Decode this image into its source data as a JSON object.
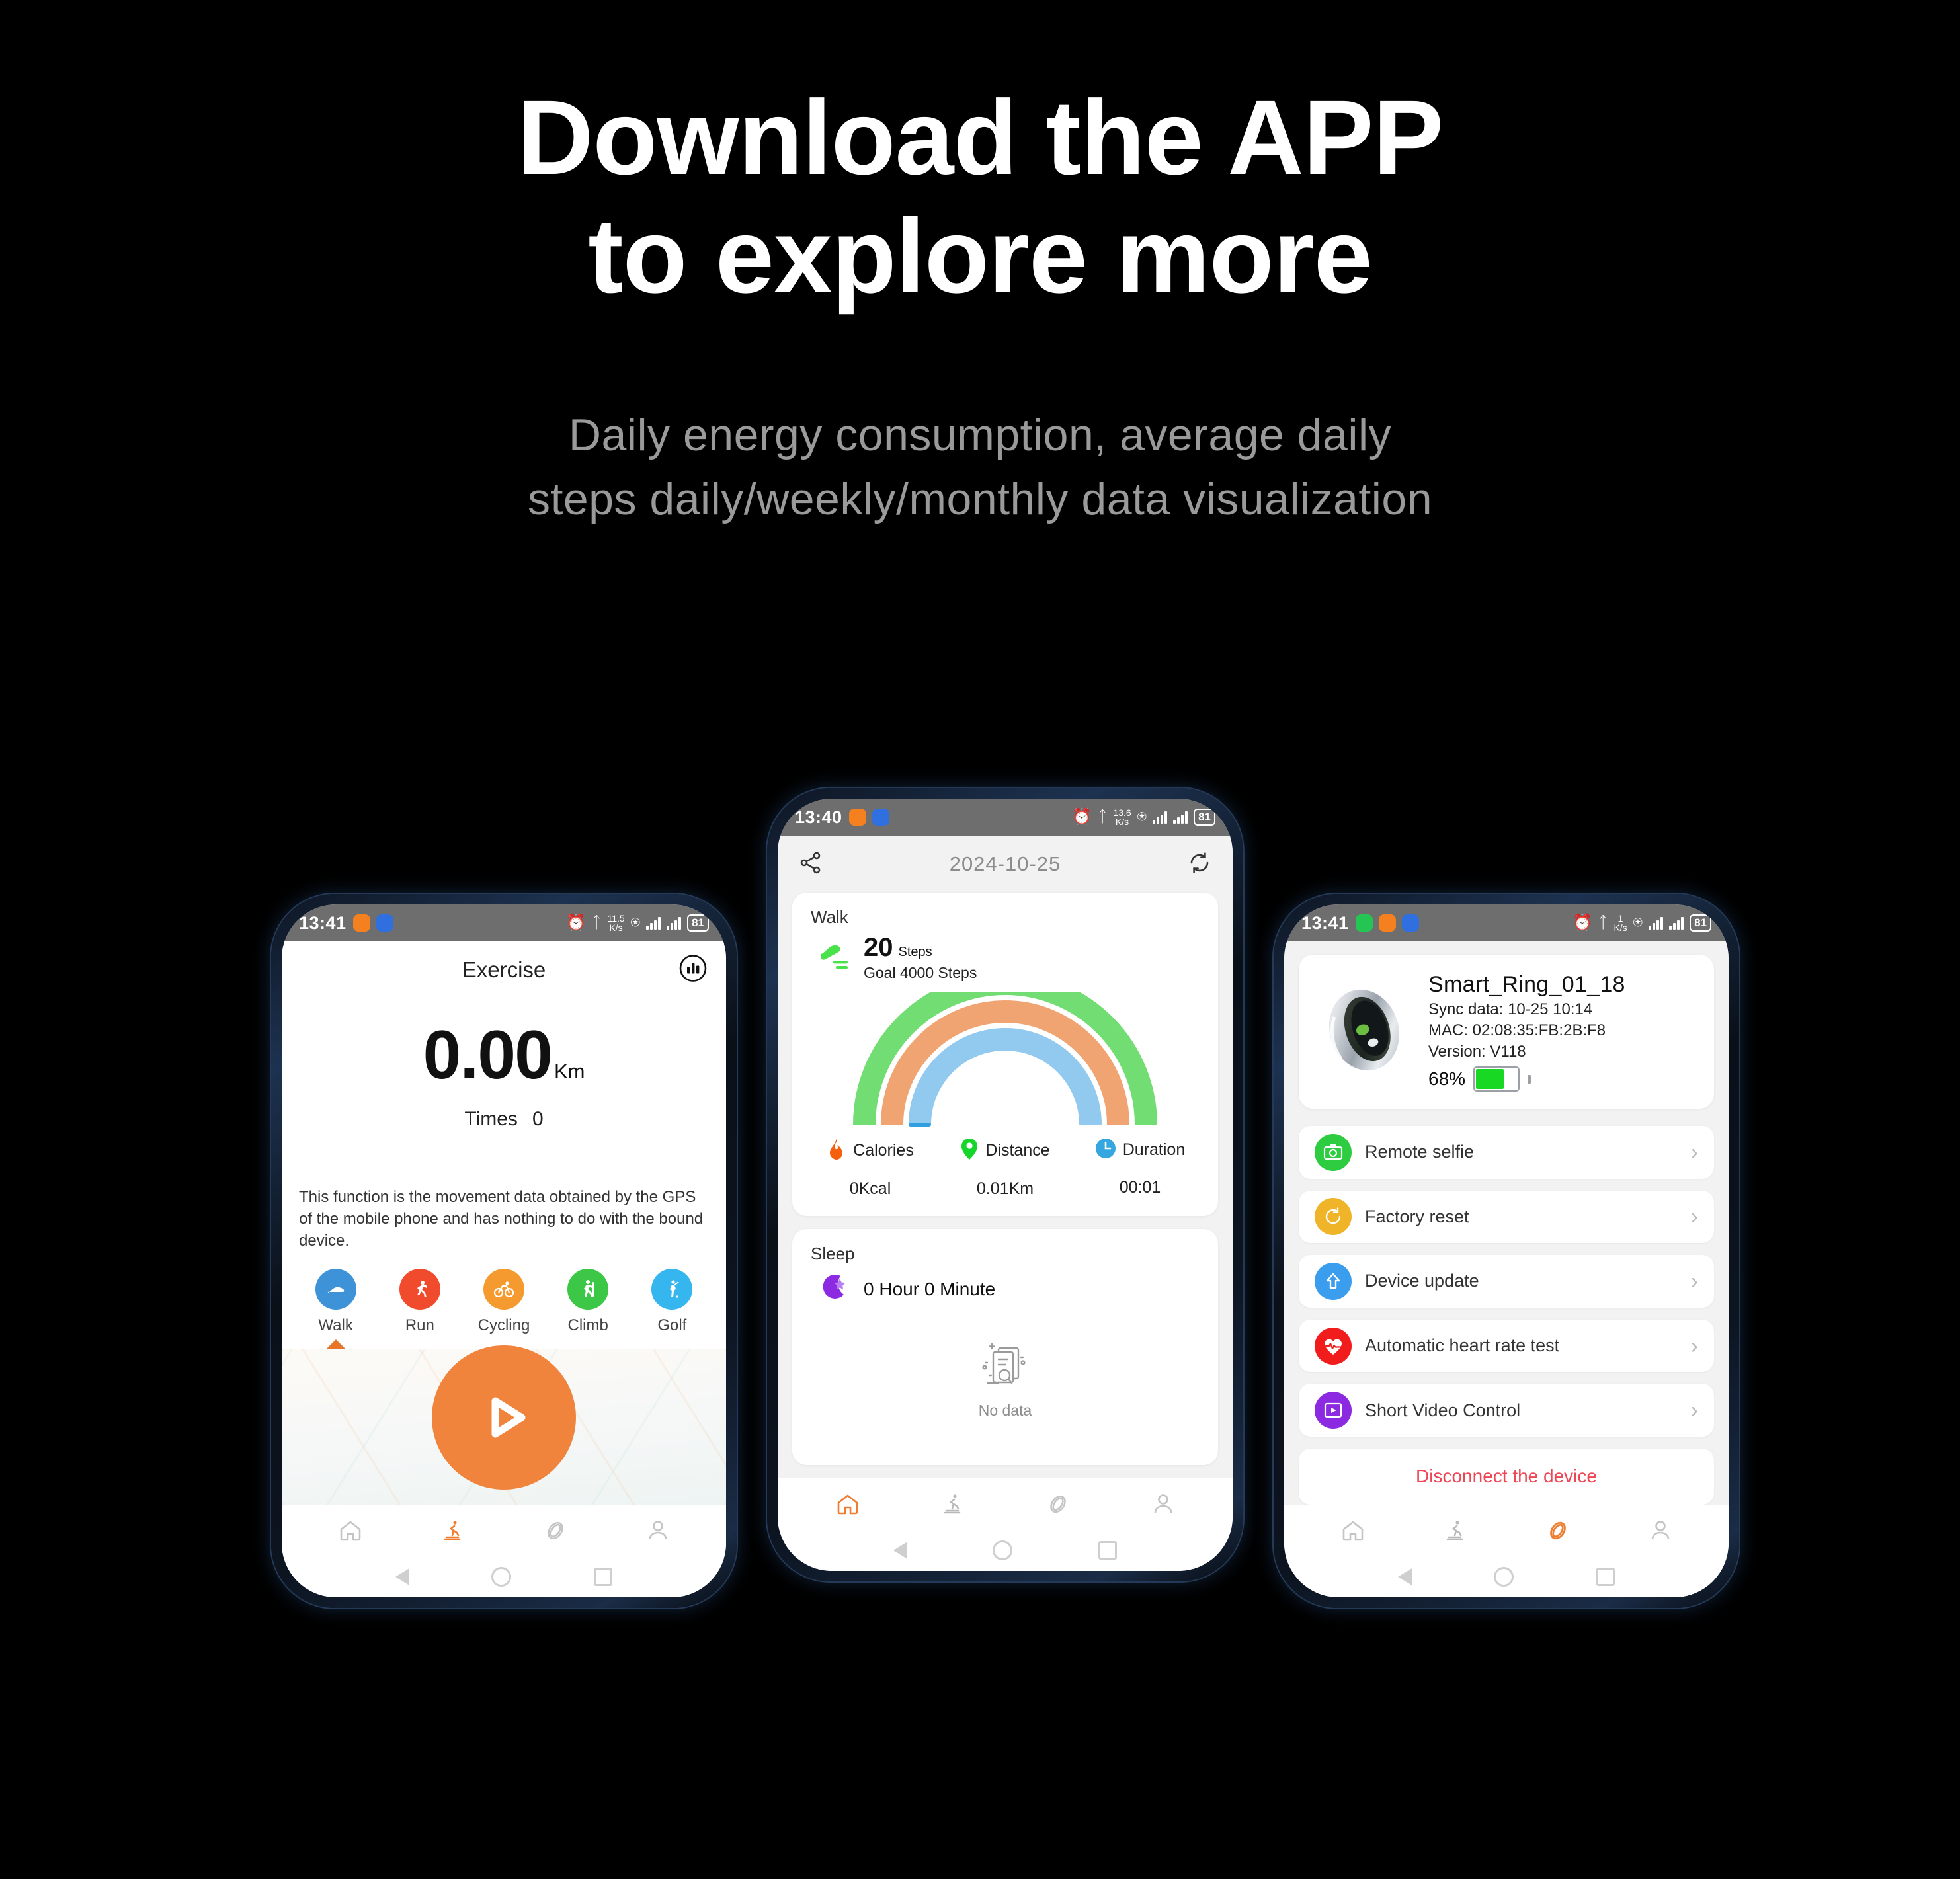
{
  "hero": {
    "title_line1": "Download the APP",
    "title_line2": "to explore more",
    "subtitle_line1": "Daily energy consumption, average daily",
    "subtitle_line2": "steps daily/weekly/monthly data visualization"
  },
  "colors": {
    "accent_orange": "#f0843c",
    "page_background": "#000000",
    "statusbar_gray": "#6e6e6e",
    "gauge_outer_green": "#72dd72",
    "gauge_middle_orange": "#f0a472",
    "gauge_inner_blue": "#92c9ee",
    "danger_red": "#ef4656",
    "battery_green": "#18d824"
  },
  "phone_left": {
    "statusbar": {
      "time": "13:41",
      "app_badges": [
        "orange-chat-badge",
        "blue-eye-badge"
      ],
      "icons": [
        "alarm-icon",
        "bluetooth-icon",
        "wifi-icon",
        "signal-icon",
        "signal-icon"
      ],
      "network_speed": "11.5",
      "network_speed_unit": "K/s",
      "battery": "81"
    },
    "header": {
      "title": "Exercise",
      "chart_icon": "bar-chart-icon"
    },
    "distance": {
      "value": "0.00",
      "unit": "Km"
    },
    "times": {
      "label": "Times",
      "value": "0"
    },
    "note": "This function is the movement data obtained by the GPS of the mobile phone and has nothing to do with the bound device.",
    "sports": [
      {
        "label": "Walk",
        "icon": "shoe-icon",
        "color": "#3e93d8",
        "selected": true
      },
      {
        "label": "Run",
        "icon": "runner-icon",
        "color": "#f04b2c",
        "selected": false
      },
      {
        "label": "Cycling",
        "icon": "bicycle-icon",
        "color": "#f59a2e",
        "selected": false
      },
      {
        "label": "Climb",
        "icon": "hiker-icon",
        "color": "#3cc746",
        "selected": false
      },
      {
        "label": "Golf",
        "icon": "golfer-icon",
        "color": "#35b6ef",
        "selected": false
      }
    ],
    "play_button": "start-exercise-button",
    "bottom_nav": [
      {
        "name": "home",
        "icon": "home-icon",
        "active": false
      },
      {
        "name": "exercise",
        "icon": "treadmill-icon",
        "active": true
      },
      {
        "name": "device",
        "icon": "ring-icon",
        "active": false
      },
      {
        "name": "profile",
        "icon": "person-icon",
        "active": false
      }
    ]
  },
  "phone_middle": {
    "statusbar": {
      "time": "13:40",
      "app_badges": [
        "orange-chat-badge",
        "blue-eye-badge"
      ],
      "network_speed": "13.6",
      "network_speed_unit": "K/s",
      "battery": "81"
    },
    "topbar": {
      "share_icon": "share-icon",
      "date": "2024-10-25",
      "refresh_icon": "refresh-icon"
    },
    "walk_card": {
      "title": "Walk",
      "steps_value": "20",
      "steps_unit": "Steps",
      "goal": "Goal 4000 Steps",
      "shoe_icon": "green-shoe-icon",
      "metrics": [
        {
          "label": "Calories",
          "value": "0Kcal",
          "icon": "flame-icon",
          "color": "#f4600d"
        },
        {
          "label": "Distance",
          "value": "0.01Km",
          "icon": "location-icon",
          "color": "#17d62b"
        },
        {
          "label": "Duration",
          "value": "00:01",
          "icon": "clock-icon",
          "color": "#35a7e0"
        }
      ]
    },
    "sleep_card": {
      "title": "Sleep",
      "moon_icon": "moon-star-icon",
      "duration": "0 Hour 0 Minute",
      "empty_icon": "no-data-document-icon",
      "empty_label": "No data"
    },
    "bottom_nav": [
      {
        "name": "home",
        "icon": "home-icon",
        "active": true
      },
      {
        "name": "exercise",
        "icon": "treadmill-icon",
        "active": false
      },
      {
        "name": "device",
        "icon": "ring-icon",
        "active": false
      },
      {
        "name": "profile",
        "icon": "person-icon",
        "active": false
      }
    ]
  },
  "phone_right": {
    "statusbar": {
      "time": "13:41",
      "app_badges": [
        "green-chat-badge",
        "orange-chat-badge",
        "blue-eye-badge"
      ],
      "network_speed": "1",
      "network_speed_unit": "K/s",
      "battery": "81"
    },
    "device_card": {
      "image": "smart-ring-photo",
      "name": "Smart_Ring_01_18",
      "sync": "Sync data: 10-25 10:14",
      "mac": "MAC: 02:08:35:FB:2B:F8",
      "version": "Version: V118",
      "battery_percent": "68%",
      "battery_level": 68
    },
    "settings": [
      {
        "label": "Remote selfie",
        "icon": "camera-icon",
        "color": "#2ecc40"
      },
      {
        "label": "Factory reset",
        "icon": "reset-icon",
        "color": "#f0b429"
      },
      {
        "label": "Device update",
        "icon": "upload-icon",
        "color": "#3b9dee"
      },
      {
        "label": "Automatic heart rate test",
        "icon": "heartbeat-icon",
        "color": "#f11d1d"
      },
      {
        "label": "Short Video Control",
        "icon": "video-play-icon",
        "color": "#8b2ae0"
      }
    ],
    "disconnect_label": "Disconnect the device",
    "bottom_nav": [
      {
        "name": "home",
        "icon": "home-icon",
        "active": false
      },
      {
        "name": "exercise",
        "icon": "treadmill-icon",
        "active": false
      },
      {
        "name": "device",
        "icon": "ring-icon",
        "active": true
      },
      {
        "name": "profile",
        "icon": "person-icon",
        "active": false
      }
    ]
  },
  "chart_data": {
    "type": "gauge",
    "title": "Walk",
    "value": 20,
    "goal": 4000,
    "unit": "Steps",
    "rings": [
      {
        "name": "outer",
        "color": "#72dd72"
      },
      {
        "name": "middle",
        "color": "#f0a472"
      },
      {
        "name": "inner",
        "color": "#92c9ee"
      }
    ],
    "metrics": {
      "calories": "0Kcal",
      "distance": "0.01Km",
      "duration": "00:01"
    },
    "date": "2024-10-25"
  }
}
